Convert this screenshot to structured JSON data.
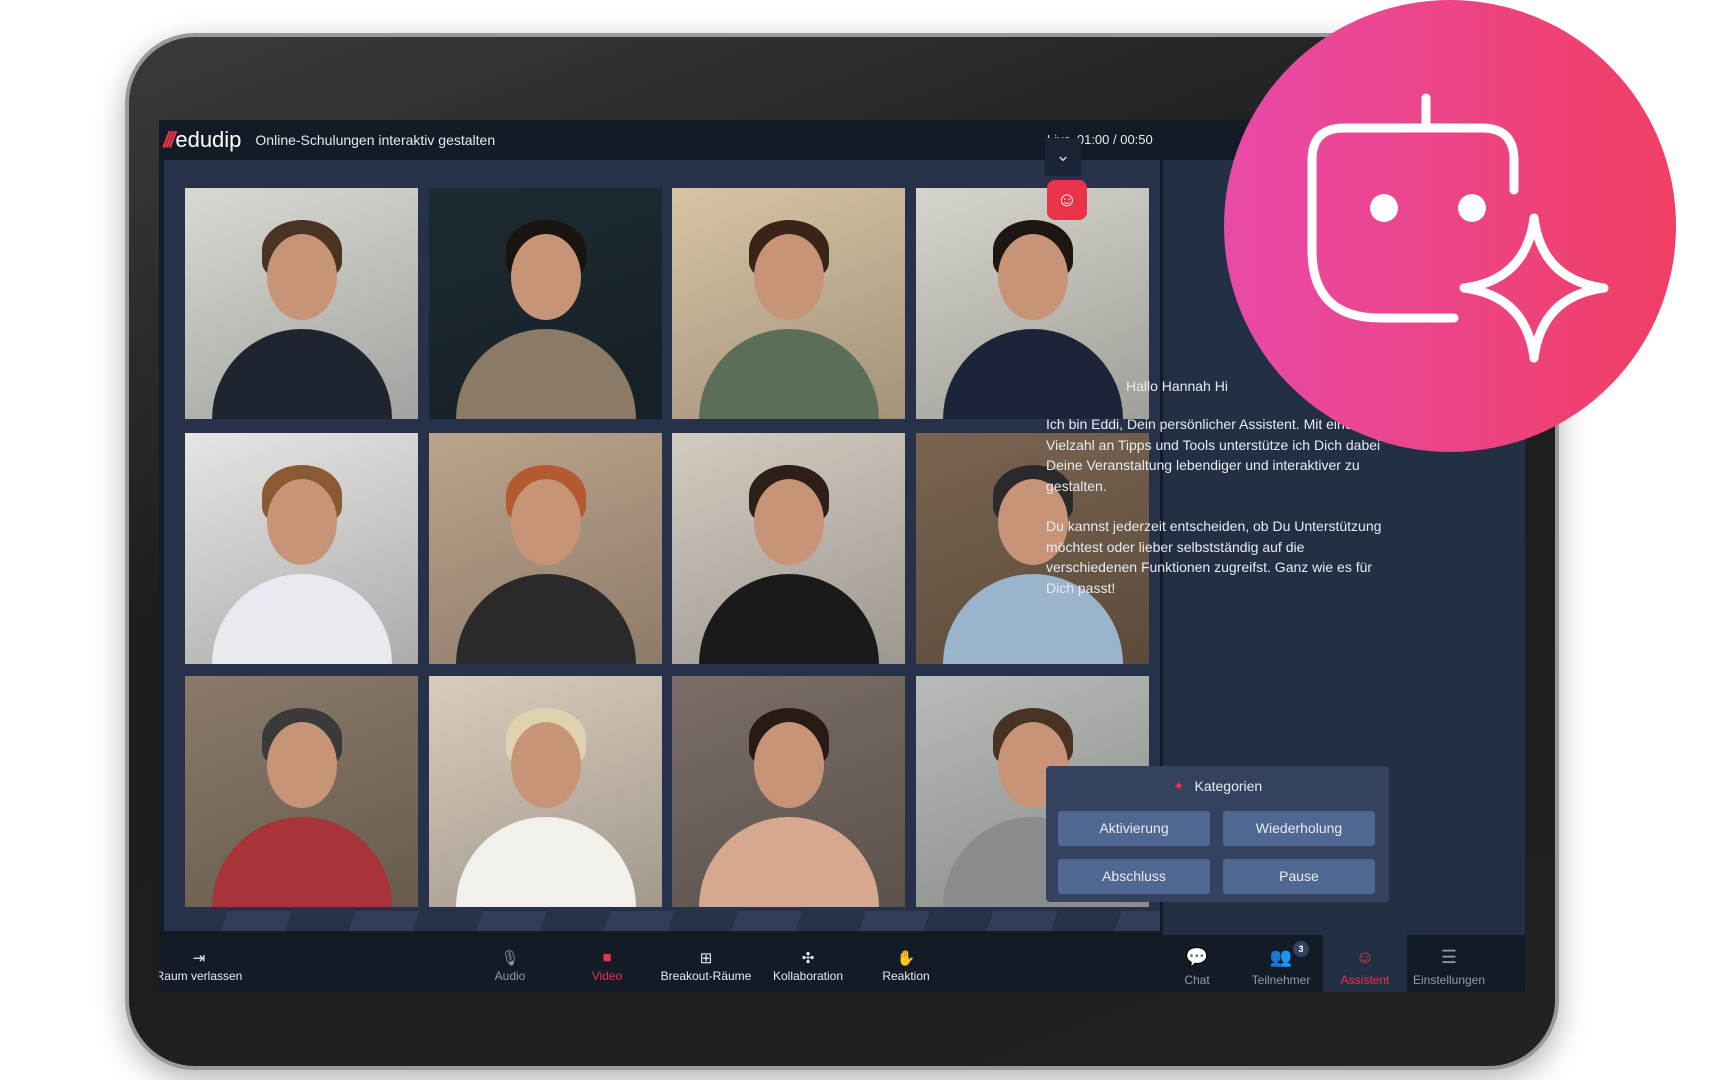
{
  "header": {
    "logo": "edudip",
    "title": "Online-Schulungen interaktiv gestalten",
    "live_label": "Live",
    "time": "01:00 / 00:50"
  },
  "video_tiles": [
    {
      "bg": "#d9d9d4",
      "hair": "#4a3322",
      "shirt": "#1f2530"
    },
    {
      "bg": "#1d2b32",
      "hair": "#1a1410",
      "shirt": "#8a7a66"
    },
    {
      "bg": "#d8c4a4",
      "hair": "#3a2418",
      "shirt": "#5d6e58"
    },
    {
      "bg": "#d6d4cc",
      "hair": "#1e1612",
      "shirt": "#1b2438"
    },
    {
      "bg": "#e5e5e3",
      "hair": "#8a5a32",
      "shirt": "#e8eaf0"
    },
    {
      "bg": "#bca48c",
      "hair": "#b35a30",
      "shirt": "#2a2a2a"
    },
    {
      "bg": "#d2cbc0",
      "hair": "#2e2018",
      "shirt": "#1a1a1a"
    },
    {
      "bg": "#7a6450",
      "hair": "#2a2a2a",
      "shirt": "#9ab4cc"
    },
    {
      "bg": "#8a7a68",
      "hair": "#3a3a3a",
      "shirt": "#a8343a"
    },
    {
      "bg": "#d8ccbc",
      "hair": "#e0d2b0",
      "shirt": "#f2f0ea"
    },
    {
      "bg": "#7a6e66",
      "hair": "#2a1a14",
      "shirt": "#d6a890"
    },
    {
      "bg": "#b8bcb8",
      "hair": "#4a3222",
      "shirt": "#8a8c90"
    }
  ],
  "assistant": {
    "greeting": "Hallo Hannah Hi",
    "paragraphs": [
      "Ich bin Eddi, Dein persönlicher Assistent. Mit einer Vielzahl an Tipps und Tools unterstütze ich Dich dabei Deine Veranstaltung lebendiger und interaktiver zu gestalten.",
      "Du kannst jederzeit entscheiden, ob Du Unterstützung möchtest oder lieber selbstständig auf die verschiedenen Funktionen zugreifst. Ganz wie es für Dich passt!"
    ],
    "categories_title": "Kategorien",
    "categories": [
      "Aktivierung",
      "Wiederholung",
      "Abschluss",
      "Pause"
    ]
  },
  "toolbar": {
    "leave": "Raum verlassen",
    "audio": "Audio",
    "video": "Video",
    "breakout": "Breakout-Räume",
    "collab": "Kollaboration",
    "reaction": "Reaktion",
    "chat": "Chat",
    "participants": "Teilnehmer",
    "participants_count": "3",
    "assistant": "Assistent",
    "settings": "Einstellungen"
  },
  "colors": {
    "accent": "#e8334a",
    "brand_gradient_start": "#e84aa9",
    "brand_gradient_end": "#f03e63"
  }
}
